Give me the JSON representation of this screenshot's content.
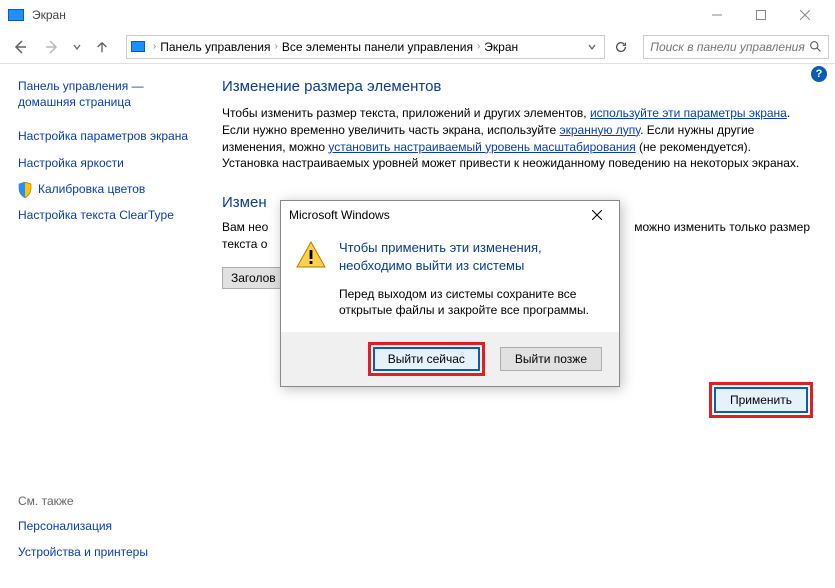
{
  "window": {
    "title": "Экран"
  },
  "toolbar": {
    "breadcrumbs": [
      "Панель управления",
      "Все элементы панели управления",
      "Экран"
    ],
    "search_placeholder": "Поиск в панели управления"
  },
  "sidebar": {
    "home": "Панель управления — домашняя страница",
    "items": [
      {
        "label": "Настройка параметров экрана",
        "shield": false
      },
      {
        "label": "Настройка яркости",
        "shield": false
      },
      {
        "label": "Калибровка цветов",
        "shield": true
      },
      {
        "label": "Настройка текста ClearType",
        "shield": false
      }
    ],
    "see_also_heading": "См. также",
    "see_also": [
      "Персонализация",
      "Устройства и принтеры"
    ]
  },
  "main": {
    "heading1": "Изменение размера элементов",
    "para1_pre": "Чтобы изменить размер текста, приложений и других элементов, ",
    "para1_link1": "используйте эти параметры экрана",
    "para1_mid": ". Если нужно временно увеличить часть экрана, используйте ",
    "para1_link2": "экранную лупу",
    "para1_mid2": ". Если нужны другие изменения, можно ",
    "para1_link3": "установить настраиваемый уровень масштабирования",
    "para1_end": " (не рекомендуется). Установка настраиваемых уровней может привести к неожиданному поведению на некоторых экранах.",
    "heading2": "Измен",
    "para2_line1": "Вам нео",
    "para2_line2": "текста о",
    "dropdown_label": "Заголов",
    "apply_button": "Применить",
    "hidden_tail": "можно изменить только размер"
  },
  "dialog": {
    "title": "Microsoft Windows",
    "heading": "Чтобы применить эти изменения, необходимо выйти из системы",
    "message": "Перед выходом из системы сохраните все открытые файлы и закройте все программы.",
    "btn_now": "Выйти сейчас",
    "btn_later": "Выйти позже"
  }
}
